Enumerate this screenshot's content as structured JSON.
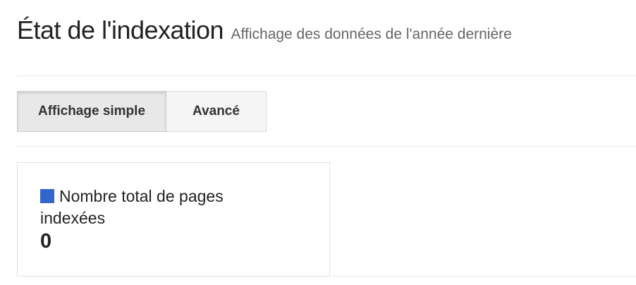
{
  "header": {
    "title": "État de l'indexation",
    "subtitle": "Affichage des données de l'année dernière"
  },
  "tabs": [
    {
      "label": "Affichage simple",
      "active": true
    },
    {
      "label": "Avancé",
      "active": false
    }
  ],
  "metric": {
    "legend_label": "Nombre total de pages indexées",
    "value": "0",
    "swatch_color": "#3366cc"
  }
}
